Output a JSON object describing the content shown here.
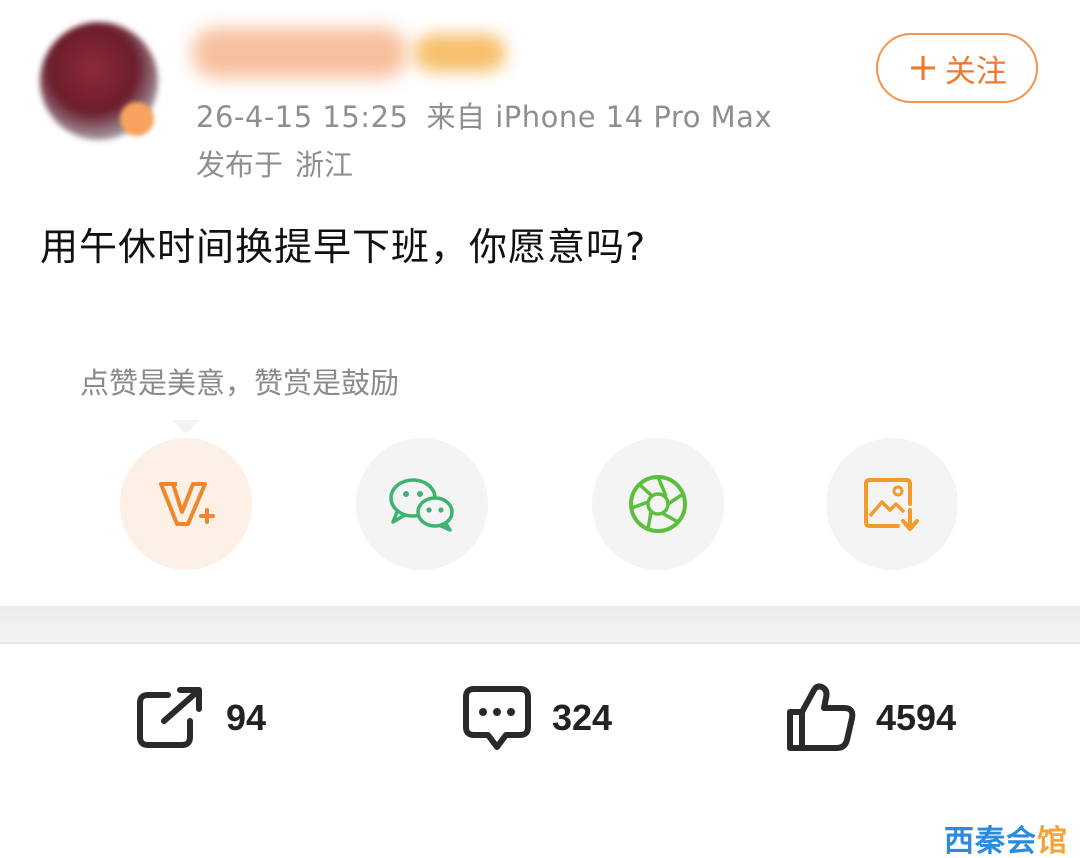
{
  "post": {
    "timestamp": "26-4-15 15:25",
    "source": "来自 iPhone 14 Pro Max",
    "location_prefix": "发布于",
    "location": "浙江",
    "text": "用午休时间换提早下班，你愿意吗?"
  },
  "header": {
    "follow_plus": "+",
    "follow_label": "关注"
  },
  "reward_tip": {
    "text": "点赞是美意，赞赏是鼓励"
  },
  "share_options": [
    {
      "icon": "reward-v-plus-icon",
      "color": "#f0852c"
    },
    {
      "icon": "wechat-icon",
      "color": "#3cb371"
    },
    {
      "icon": "moments-aperture-icon",
      "color": "#5cbf3c"
    },
    {
      "icon": "save-image-icon",
      "color": "#f29a2a"
    }
  ],
  "actions": {
    "repost_count": "94",
    "comment_count": "324",
    "like_count": "4594"
  },
  "watermark": {
    "text_main": "西秦会",
    "text_accent": "馆"
  },
  "colors": {
    "accent_orange": "#f0782f",
    "meta_gray": "#8f8f8f"
  }
}
